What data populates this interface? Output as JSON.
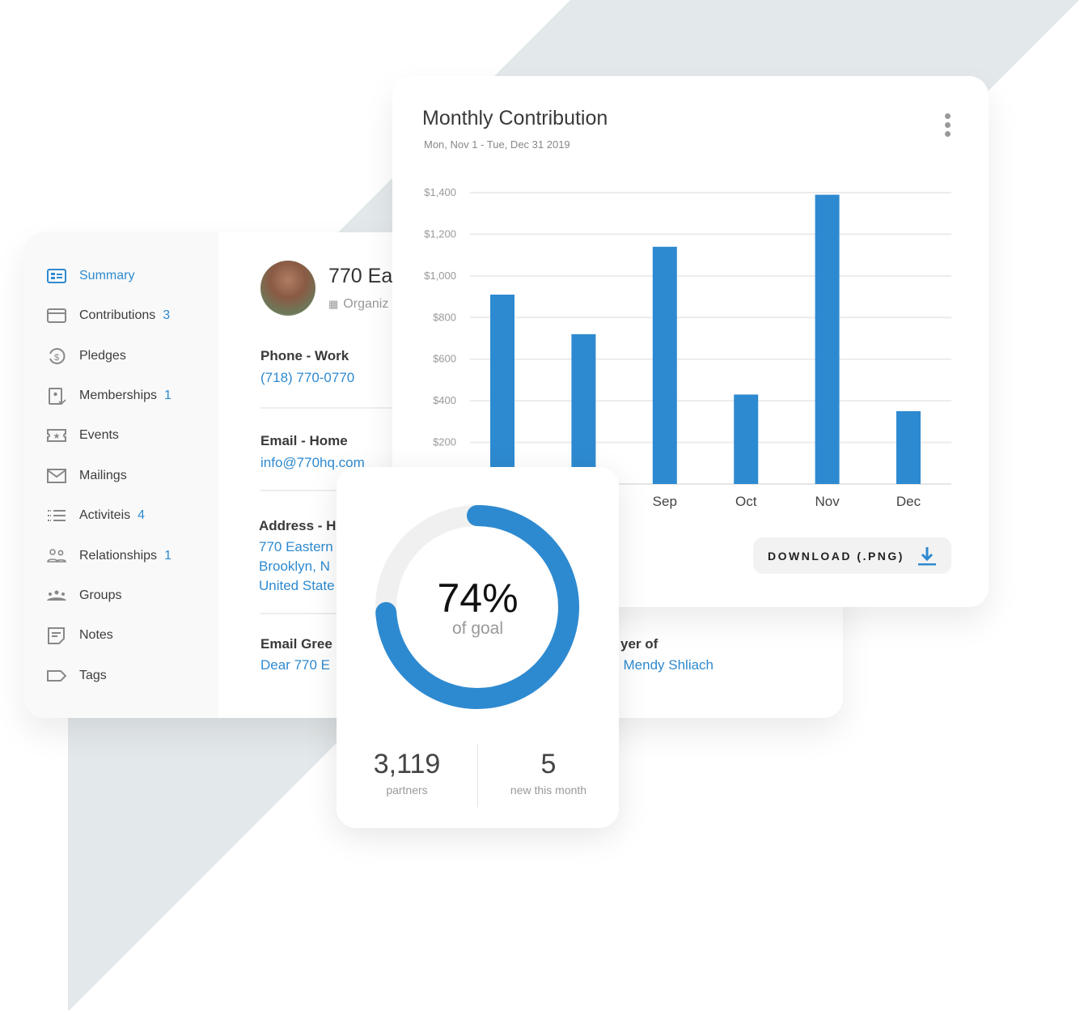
{
  "colors": {
    "accent": "#2e8ad0",
    "background_shape": "#e3e8ea"
  },
  "sidebar": {
    "items": [
      {
        "label": "Summary",
        "count": "",
        "icon": "id-card-icon",
        "active": true
      },
      {
        "label": "Contributions",
        "count": "3",
        "icon": "credit-card-icon"
      },
      {
        "label": "Pledges",
        "count": "",
        "icon": "dollar-cycle-icon"
      },
      {
        "label": "Memberships",
        "count": "1",
        "icon": "membership-badge-icon"
      },
      {
        "label": "Events",
        "count": "",
        "icon": "ticket-star-icon"
      },
      {
        "label": "Mailings",
        "count": "",
        "icon": "envelope-icon"
      },
      {
        "label": "Activiteis",
        "count": "4",
        "icon": "checklist-icon"
      },
      {
        "label": "Relationships",
        "count": "1",
        "icon": "people-icon"
      },
      {
        "label": "Groups",
        "count": "",
        "icon": "group-icon"
      },
      {
        "label": "Notes",
        "count": "",
        "icon": "note-icon"
      },
      {
        "label": "Tags",
        "count": "",
        "icon": "tag-icon"
      }
    ]
  },
  "profile": {
    "name": "770 Ea",
    "type": "Organiz",
    "fields": [
      {
        "label": "Phone - Work",
        "values": [
          "(718) 770-0770"
        ]
      },
      {
        "label": "Email - Home",
        "values": [
          "info@770hq.com"
        ]
      },
      {
        "label": "Address - H",
        "values": [
          "770 Eastern",
          "Brooklyn, N",
          "United State"
        ]
      },
      {
        "label": "Email Gree",
        "values": [
          "Dear 770 E"
        ]
      },
      {
        "label": "yer of",
        "values": [
          "i Mendy Shliach"
        ]
      }
    ]
  },
  "chart": {
    "title": "Monthly Contribution",
    "date_range": "Mon, Nov 1 - Tue, Dec 31 2019",
    "download_label": "DOWNLOAD (.PNG)"
  },
  "chart_data": {
    "type": "bar",
    "categories": [
      "",
      "",
      "Sep",
      "Oct",
      "Nov",
      "Dec"
    ],
    "values": [
      910,
      720,
      1140,
      430,
      1390,
      350
    ],
    "ylim": [
      0,
      1400
    ],
    "yticks": [
      "$200",
      "$400",
      "$600",
      "$800",
      "$1,000",
      "$1,200",
      "$1,400"
    ],
    "ytick_values": [
      200,
      400,
      600,
      800,
      1000,
      1200,
      1400
    ],
    "grid": true,
    "color": "#2e8ad0"
  },
  "goal": {
    "percent": 74,
    "percent_label": "74%",
    "caption": "of goal",
    "stats": [
      {
        "value": "3,119",
        "label": "partners"
      },
      {
        "value": "5",
        "label": "new this month"
      }
    ]
  }
}
